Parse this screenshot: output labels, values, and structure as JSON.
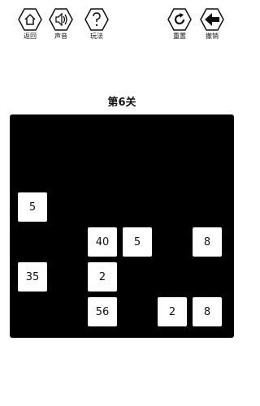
{
  "toolbar": {
    "back_label": "返回",
    "sound_label": "声音",
    "help_label": "玩法",
    "reset_label": "重置",
    "undo_label": "撤销"
  },
  "level": {
    "title": "第6关"
  },
  "board": {
    "tiles": [
      {
        "value": "5",
        "col": 0,
        "row": 2
      },
      {
        "value": "40",
        "col": 2,
        "row": 3
      },
      {
        "value": "5",
        "col": 3,
        "row": 3
      },
      {
        "value": "8",
        "col": 5,
        "row": 3
      },
      {
        "value": "35",
        "col": 0,
        "row": 4
      },
      {
        "value": "2",
        "col": 2,
        "row": 4
      },
      {
        "value": "56",
        "col": 2,
        "row": 5
      },
      {
        "value": "2",
        "col": 4,
        "row": 5
      },
      {
        "value": "8",
        "col": 5,
        "row": 5
      }
    ]
  },
  "colors": {
    "board": "#000000",
    "tile": "#ffffff",
    "text": "#111111"
  }
}
